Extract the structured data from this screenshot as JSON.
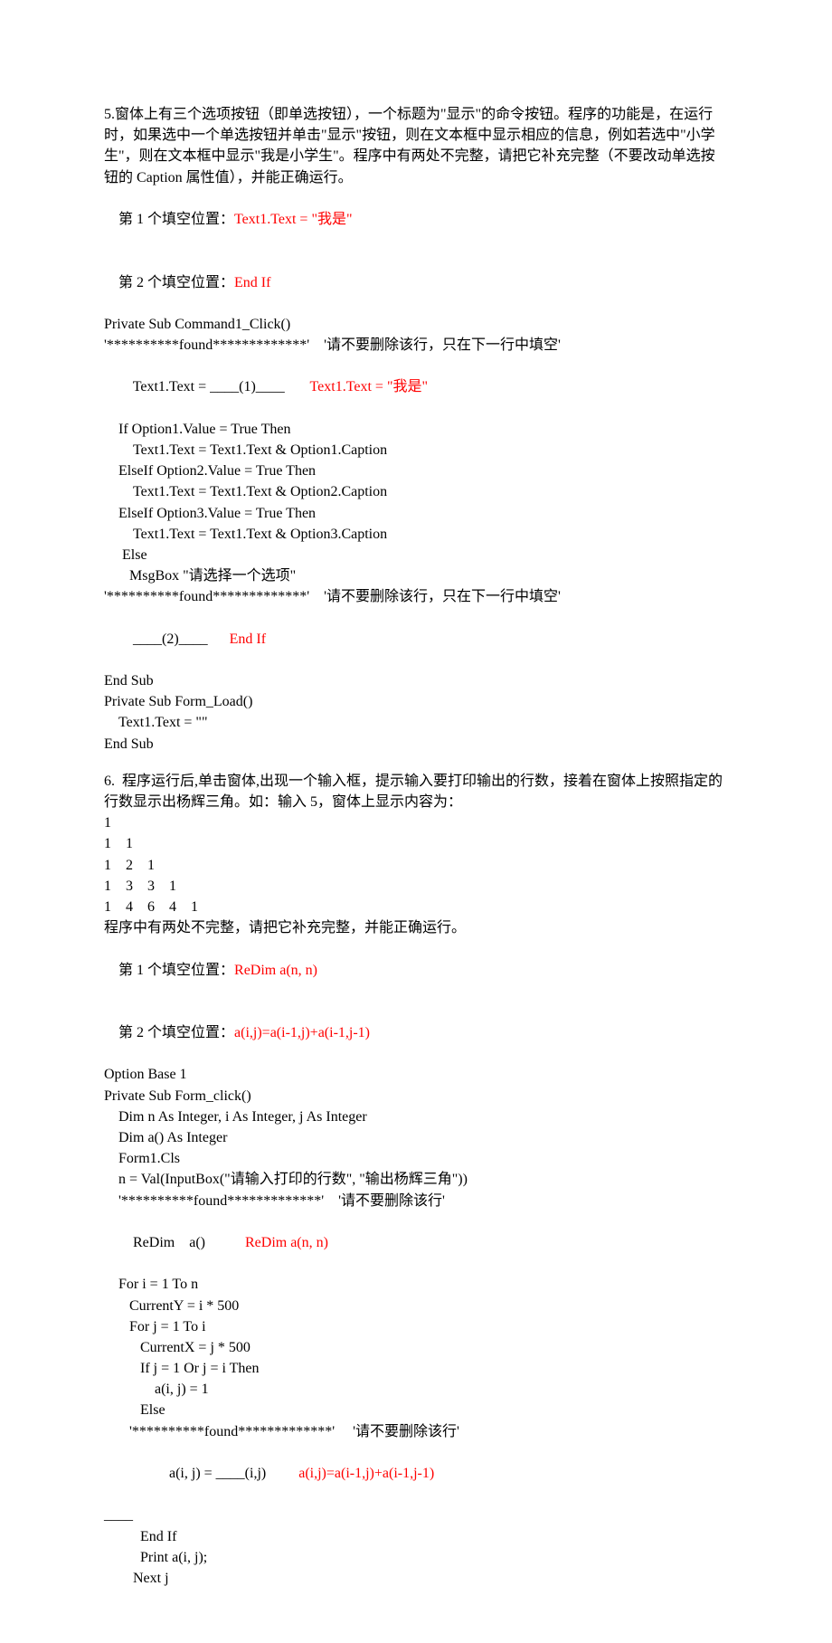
{
  "q5": {
    "desc": [
      "5.窗体上有三个选项按钮（即单选按钮），一个标题为\"显示\"的命令按钮。程序的功能是，在运行时，如果选中一个单选按钮并单击\"显示\"按钮，则在文本框中显示相应的信息，例如若选中\"小学生\"，则在文本框中显示\"我是小学生\"。程序中有两处不完整，请把它补充完整（不要改动单选按钮的 Caption 属性值），并能正确运行。"
    ],
    "blank1_label": "第 1 个填空位置：",
    "blank1_ans": "Text1.Text = \"我是\"",
    "blank2_label": "第 2 个填空位置：",
    "blank2_ans": "End If",
    "code": {
      "l1": "Private Sub Command1_Click()",
      "l2": "'**********found*************'    '请不要删除该行，只在下一行中填空'",
      "l3a": "    Text1.Text = ____(1)____",
      "l3b": "Text1.Text = \"我是\"",
      "l4": "    If Option1.Value = True Then",
      "l5": "        Text1.Text = Text1.Text & Option1.Caption",
      "l6": "    ElseIf Option2.Value = True Then",
      "l7": "        Text1.Text = Text1.Text & Option2.Caption",
      "l8": "    ElseIf Option3.Value = True Then",
      "l9": "        Text1.Text = Text1.Text & Option3.Caption",
      "l10": "     Else",
      "l11": "       MsgBox \"请选择一个选项\"",
      "l12": "'**********found*************'    '请不要删除该行，只在下一行中填空'",
      "l13a": "    ____(2)____",
      "l13b": "End If",
      "l14": "End Sub",
      "l15": "Private Sub Form_Load()",
      "l16": "    Text1.Text = \"\"",
      "l17": "End Sub"
    }
  },
  "q6": {
    "desc": [
      "6.  程序运行后,单击窗体,出现一个输入框，提示输入要打印输出的行数，接着在窗体上按照指定的行数显示出杨辉三角。如：输入 5，窗体上显示内容为："
    ],
    "triangle": [
      "1",
      "1    1",
      "1    2    1",
      "1    3    3    1",
      "1    4    6    4    1"
    ],
    "desc2": "程序中有两处不完整，请把它补充完整，并能正确运行。",
    "blank1_label": "第 1 个填空位置：",
    "blank1_ans": "ReDim a(n, n)",
    "blank2_label": "第 2 个填空位置：",
    "blank2_ans": "a(i,j)=a(i-1,j)+a(i-1,j-1)",
    "code": {
      "l1": "Option Base 1",
      "l2": "Private Sub Form_click()",
      "l3": "    Dim n As Integer, i As Integer, j As Integer",
      "l4": "    Dim a() As Integer",
      "l5": "    Form1.Cls",
      "l6": "    n = Val(InputBox(\"请输入打印的行数\", \"输出杨辉三角\"))",
      "l7": "    '**********found*************'    '请不要删除该行'",
      "l8a": "    ReDim    a()",
      "l8b": "ReDim a(n, n)",
      "l9": "    For i = 1 To n",
      "l10": "       CurrentY = i * 500",
      "l11": "       For j = 1 To i",
      "l12": "          CurrentX = j * 500",
      "l13": "          If j = 1 Or j = i Then",
      "l14": "              a(i, j) = 1",
      "l15": "          Else",
      "l16": "       '**********found*************'     '请不要删除该行'",
      "l17a": "              a(i, j) = ____(i,j)",
      "l17b": "a(i,j)=a(i-1,j)+a(i-1,j-1)",
      "l17c": "____",
      "l18": "          End If",
      "l19": "          Print a(i, j);",
      "l20": "        Next j"
    }
  }
}
